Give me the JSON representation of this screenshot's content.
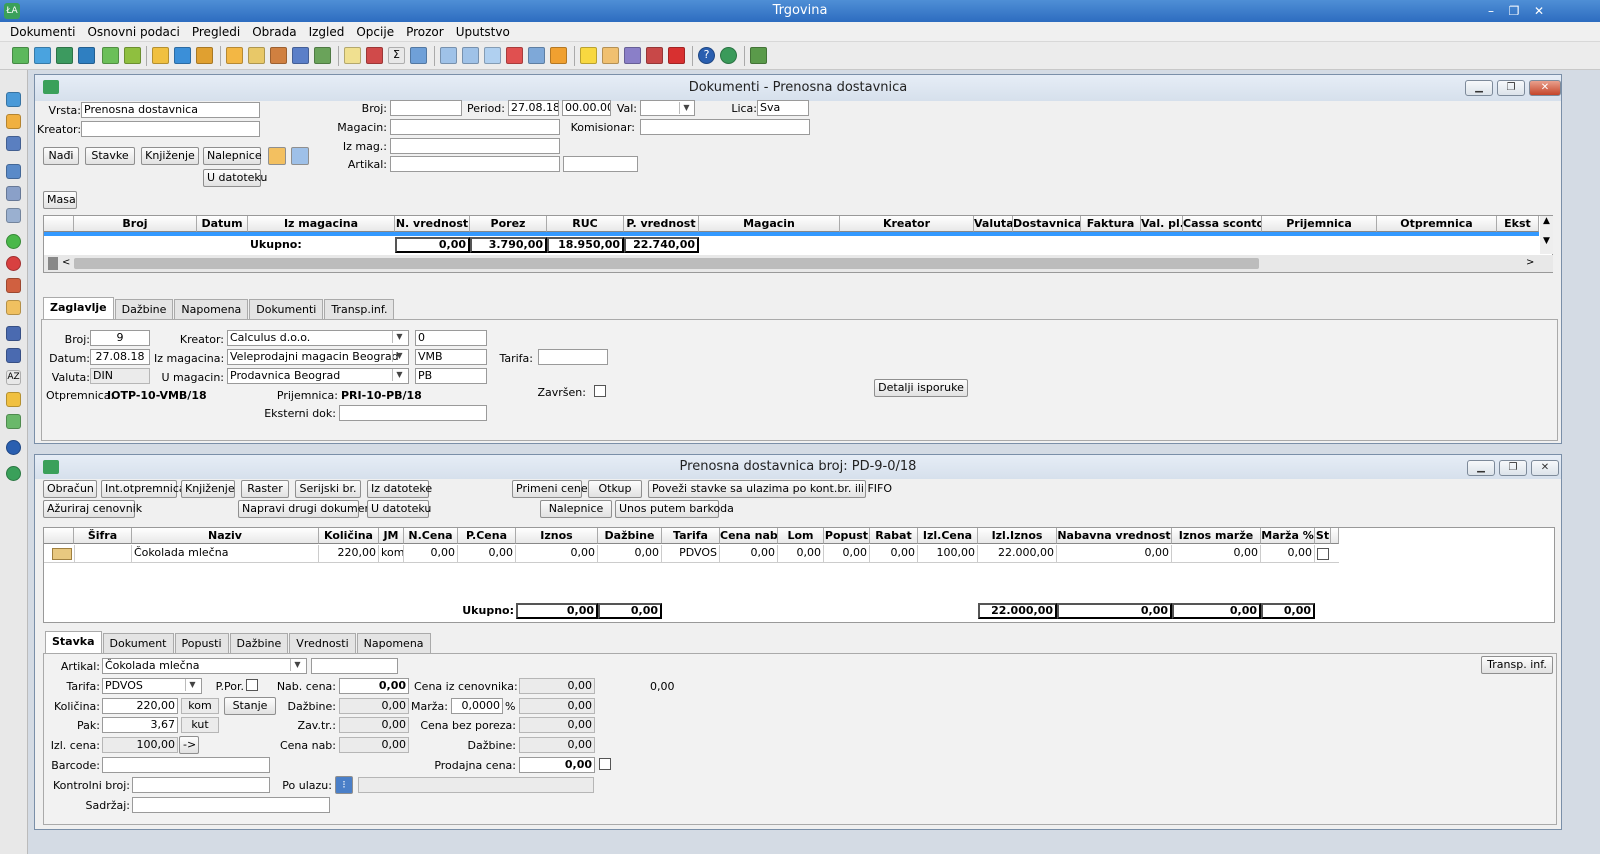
{
  "app": {
    "title": "Trgovina"
  },
  "menu": [
    "Dokumenti",
    "Osnovni podaci",
    "Pregledi",
    "Obrada",
    "Izgled",
    "Opcije",
    "Prozor",
    "Uputstvo"
  ],
  "colors": {
    "titlebar": "#2d6cc0",
    "selection": "#3399ff",
    "close": "#c4452a"
  },
  "win1": {
    "title": "Dokumenti - Prenosna dostavnica",
    "filters": {
      "vrsta_label": "Vrsta:",
      "vrsta": "Prenosna dostavnica",
      "kreator_label": "Kreator:",
      "kreator": "",
      "broj_label": "Broj:",
      "broj": "",
      "period_label": "Period:",
      "period_date": "27.08.18",
      "period_time": "00.00.00",
      "val_label": "Val:",
      "lica_label": "Lica:",
      "lica": "Sva",
      "magacin_label": "Magacin:",
      "komisionar_label": "Komisionar:",
      "izmag_label": "Iz mag.:",
      "artikal_label": "Artikal:"
    },
    "buttons": {
      "nadji": "Nađi",
      "stavke": "Stavke",
      "knjizenje": "Knjiženje",
      "nalepnice": "Nalepnice",
      "udatoteku": "U datoteku",
      "masa": "Masa"
    },
    "grid": {
      "headers": [
        "Broj",
        "Datum",
        "Iz magacina",
        "N. vrednost",
        "Porez",
        "RUC",
        "P. vrednost",
        "Magacin",
        "Kreator",
        "Valuta",
        "Dostavnica",
        "Faktura",
        "Val. pl.",
        "Cassa sconto",
        "Prijemnica",
        "Otpremnica",
        "Ekst"
      ],
      "total_label": "Ukupno:",
      "totals": [
        "0,00",
        "3.790,00",
        "18.950,00",
        "22.740,00"
      ]
    },
    "tabs": [
      "Zaglavlje",
      "Dažbine",
      "Napomena",
      "Dokumenti",
      "Transp.inf."
    ],
    "header": {
      "broj_label": "Broj:",
      "broj": "9",
      "datum_label": "Datum:",
      "datum": "27.08.18",
      "valuta_label": "Valuta:",
      "valuta": "DIN",
      "kreator_label": "Kreator:",
      "kreator": "Calculus d.o.o.",
      "kreator_code": "0",
      "izmag_label": "Iz magacina:",
      "izmag": "Veleprodajni magacin Beograd",
      "izmag_code": "VMB",
      "umag_label": "U magacin:",
      "umag": "Prodavnica Beograd",
      "umag_code": "PB",
      "tarifa_label": "Tarifa:",
      "tarifa": "",
      "otpremnica_label": "Otpremnica:",
      "otpremnica": "IOTP-10-VMB/18",
      "prijemnica_label": "Prijemnica:",
      "prijemnica": "PRI-10-PB/18",
      "zavrsen_label": "Završen:",
      "eksterni_label": "Eksterni dok:",
      "eksterni": "",
      "detalji": "Detalji isporuke"
    }
  },
  "win2": {
    "title": "Prenosna dostavnica broj: PD-9-0/18",
    "buttons": {
      "obracun": "Obračun",
      "intotp": "Int.otpremnica",
      "knjizenje": "Knjiženje",
      "raster": "Raster",
      "serijski": "Serijski br.",
      "izdatoteke": "Iz datoteke",
      "primeni": "Primeni cene",
      "otkup": "Otkup",
      "povezi": "Poveži stavke sa ulazima po kont.br. ili FIFO",
      "azuriraj": "Ažuriraj cenovnik",
      "napravi": "Napravi drugi dokument",
      "udatoteku": "U datoteku",
      "nalepnice": "Nalepnice",
      "unos": "Unos putem barkoda"
    },
    "grid": {
      "headers": [
        "Šifra",
        "Naziv",
        "Količina",
        "JM",
        "N.Cena",
        "P.Cena",
        "Iznos",
        "Dažbine",
        "Tarifa",
        "Cena nab.",
        "Lom",
        "Popust",
        "Rabat",
        "Izl.Cena",
        "Izl.Iznos",
        "Nabavna vrednost",
        "Iznos marže",
        "Marža %",
        "St"
      ],
      "row": [
        "",
        "Čokolada mlečna",
        "220,00",
        "kom",
        "0,00",
        "0,00",
        "0,00",
        "0,00",
        "PDVOS",
        "0,00",
        "0,00",
        "0,00",
        "0,00",
        "100,00",
        "22.000,00",
        "0,00",
        "0,00",
        "0,00"
      ],
      "total_label": "Ukupno:",
      "totals": [
        "0,00",
        "0,00",
        "22.000,00",
        "0,00",
        "0,00",
        "0,00"
      ]
    },
    "tabs": [
      "Stavka",
      "Dokument",
      "Popusti",
      "Dažbine",
      "Vrednosti",
      "Napomena"
    ],
    "stavka": {
      "artikal_label": "Artikal:",
      "artikal": "Čokolada mlečna",
      "tarifa_label": "Tarifa:",
      "tarifa": "PDVOS",
      "ppor_label": "P.Por.",
      "kolicina_label": "Količina:",
      "kolicina": "220,00",
      "jm": "kom",
      "stanje": "Stanje",
      "pak_label": "Pak:",
      "pak": "3,67",
      "pak_jm": "kut",
      "izlcena_label": "Izl. cena:",
      "izlcena": "100,00",
      "arrow": "->",
      "barcode_label": "Barcode:",
      "kontrolni_label": "Kontrolni broj:",
      "sadrzaj_label": "Sadržaj:",
      "nabcena_label": "Nab. cena:",
      "nabcena": "0,00",
      "dazbine_label": "Dažbine:",
      "dazbine": "0,00",
      "zavtr_label": "Zav.tr.:",
      "zavtr": "0,00",
      "cenanab_label": "Cena nab:",
      "cenanab": "0,00",
      "poulazu_label": "Po ulazu:",
      "marza_label": "Marža:",
      "marza": "0,0000",
      "pct": "%",
      "cenaizcen_label": "Cena iz cenovnika:",
      "cenaizcen": "0,00",
      "marza_val": "0,00",
      "cenabez_label": "Cena bez poreza:",
      "cenabez": "0,00",
      "dazbine2_label": "Dažbine:",
      "dazbine2": "0,00",
      "prodajna_label": "Prodajna cena:",
      "prodajna": "0,00",
      "extra": "0,00",
      "transp": "Transp. inf."
    }
  }
}
